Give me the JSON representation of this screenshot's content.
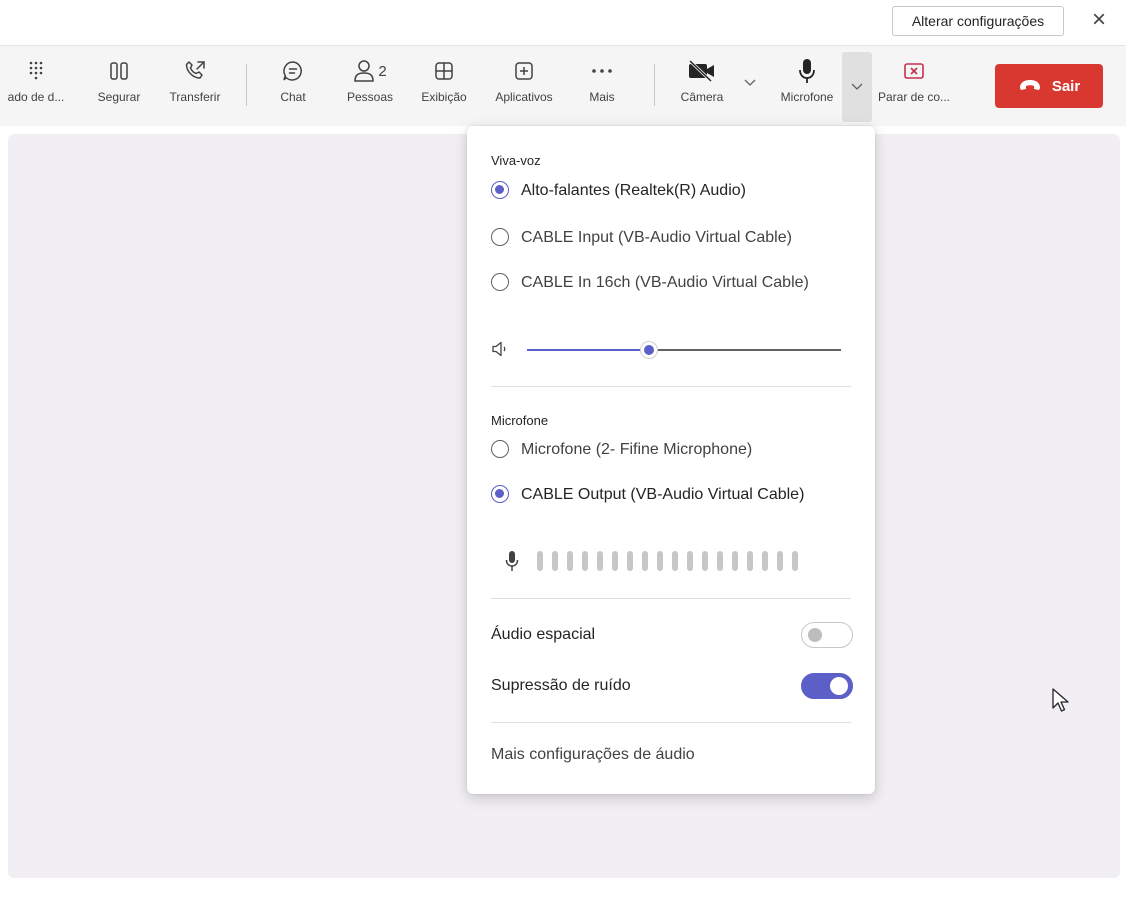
{
  "window": {
    "change_settings_label": "Alterar configurações",
    "close_symbol": "×"
  },
  "toolbar": {
    "items": [
      {
        "label": "ado de d...",
        "icon": "dialpad-icon"
      },
      {
        "label": "Segurar",
        "icon": "pause-icon"
      },
      {
        "label": "Transferir",
        "icon": "transfer-call-icon"
      },
      {
        "label": "Chat",
        "icon": "chat-icon"
      },
      {
        "label": "Pessoas",
        "icon": "people-icon",
        "badge": "2"
      },
      {
        "label": "Exibição",
        "icon": "grid-view-icon"
      },
      {
        "label": "Aplicativos",
        "icon": "add-app-icon"
      },
      {
        "label": "Mais",
        "icon": "more-icon"
      },
      {
        "label": "Câmera",
        "icon": "camera-off-icon"
      },
      {
        "label": "Microfone",
        "icon": "microphone-icon"
      },
      {
        "label": "Parar de co...",
        "icon": "stop-sharing-icon"
      }
    ],
    "leave_label": "Sair"
  },
  "audio_panel": {
    "speaker_section_title": "Viva-voz",
    "speakers": [
      {
        "label": "Alto-falantes (Realtek(R) Audio)",
        "selected": true
      },
      {
        "label": "CABLE Input (VB-Audio Virtual Cable)",
        "selected": false
      },
      {
        "label": "CABLE In 16ch (VB-Audio Virtual Cable)",
        "selected": false
      }
    ],
    "speaker_volume_fraction": 0.39,
    "microphone_section_title": "Microfone",
    "microphones": [
      {
        "label": "Microfone (2- Fifine Microphone)",
        "selected": false
      },
      {
        "label": "CABLE Output (VB-Audio Virtual Cable)",
        "selected": true
      }
    ],
    "mic_level_bars_lit": 0,
    "toggles": [
      {
        "label": "Áudio espacial",
        "on": false
      },
      {
        "label": "Supressão de ruído",
        "on": true
      }
    ],
    "more_audio_settings": "Mais configurações de áudio"
  },
  "colors": {
    "accent": "#5b5fc7",
    "leave": "#d93831",
    "stage_bg": "#f1eff3"
  }
}
